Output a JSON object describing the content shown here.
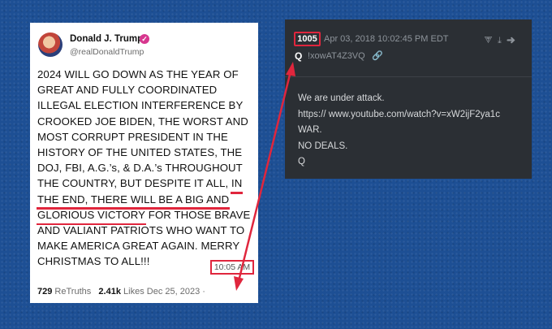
{
  "truth_post": {
    "author_name": "Donald J. Trump",
    "author_handle": "@realDonaldTrump",
    "verified_glyph": "✓",
    "body_lines": [
      "2024 WILL GO DOWN AS THE YEAR OF",
      "GREAT AND FULLY COORDINATED",
      "ILLEGAL ELECTION INTERFERENCE BY",
      "CROOKED JOE BIDEN, THE WORST AND",
      "MOST CORRUPT PRESIDENT IN THE",
      "HISTORY OF THE UNITED STATES, THE",
      "DOJ, FBI, A.G.’s, & D.A.’s THROUGHOUT",
      "THE COUNTRY, BUT DESPITE IT ALL,",
      "IN",
      "THE END, THERE WILL BE A BIG AND",
      "GLORIOUS VICTORY",
      " FOR THOSE BRAVE",
      "AND VALIANT PATRIOTS WHO WANT TO",
      "MAKE AMERICA GREAT AGAIN. MERRY",
      "CHRISTMAS TO ALL!!!"
    ],
    "retruths_count": "729",
    "retruths_label": "ReTruths",
    "likes_count": "2.41k",
    "likes_label": "Likes",
    "date": "Dec 25, 2023 ·",
    "time": "10:05 AM"
  },
  "q_post": {
    "post_number": "1005",
    "datetime": "Apr 03, 2018 10:02:45 PM EDT",
    "action_icons": "⮗⤓➜",
    "name": "Q",
    "tripcode": "!xowAT4Z3VQ",
    "link_icon": "🔗",
    "body_lines": [
      "We are under attack.",
      "https:// www.youtube.com/watch?v=xW2ijF2ya1c",
      "WAR.",
      "NO DEALS.",
      "Q"
    ]
  },
  "colors": {
    "background": "#1d4f94",
    "highlight_red": "#e0263d",
    "q_card_bg": "#2b2f34",
    "verified_pink": "#d7368e"
  }
}
